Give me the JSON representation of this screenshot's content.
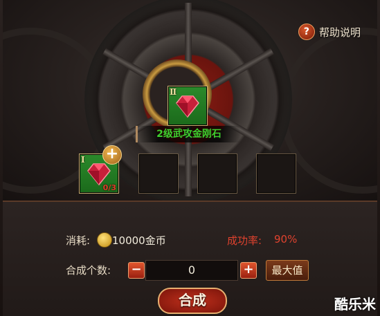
{
  "help": {
    "label": "帮助说明"
  },
  "target": {
    "tier": "Ⅱ",
    "name": "2级武攻金刚石"
  },
  "material": {
    "tier": "Ⅰ",
    "count": "0/3"
  },
  "cost": {
    "label": "消耗:",
    "value": "10000金币"
  },
  "success": {
    "label": "成功率:",
    "value": "90%"
  },
  "quantity": {
    "label": "合成个数:",
    "value": "0"
  },
  "buttons": {
    "minus": "−",
    "plus": "+",
    "max": "最大值",
    "compose": "合成",
    "add_material": "+"
  },
  "watermark": "酷乐米",
  "colors": {
    "gem_red": "#d8324a",
    "slot_green": "#2b8a2b",
    "accent_red": "#e0422e",
    "name_green": "#3ed02e"
  },
  "icons": {
    "help": "question-icon",
    "coin": "gold-coin-icon",
    "gem": "ruby-gem-icon"
  }
}
